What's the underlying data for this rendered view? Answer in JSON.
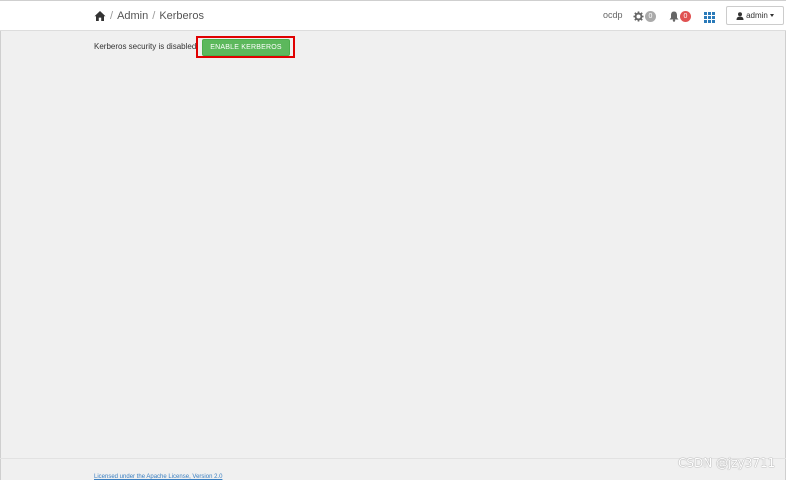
{
  "breadcrumb": {
    "home_icon": "home-icon",
    "items": [
      "Admin",
      "Kerberos"
    ],
    "separator": "/"
  },
  "header": {
    "cluster_name": "ocdp",
    "ops_count": "0",
    "alerts_count": "0",
    "apps_icon": "grid-icon",
    "user_label": "admin"
  },
  "main": {
    "status_text": "Kerberos security is disabled",
    "enable_button_label": "ENABLE KERBEROS"
  },
  "footer": {
    "license_text": "Licensed under the Apache License, Version 2.0"
  },
  "watermark": "CSDN @jzy3711",
  "colors": {
    "enable_button": "#5cb85c",
    "alert_badge": "#e05252",
    "ops_badge": "#aaaaaa",
    "highlight": "#e00000"
  }
}
